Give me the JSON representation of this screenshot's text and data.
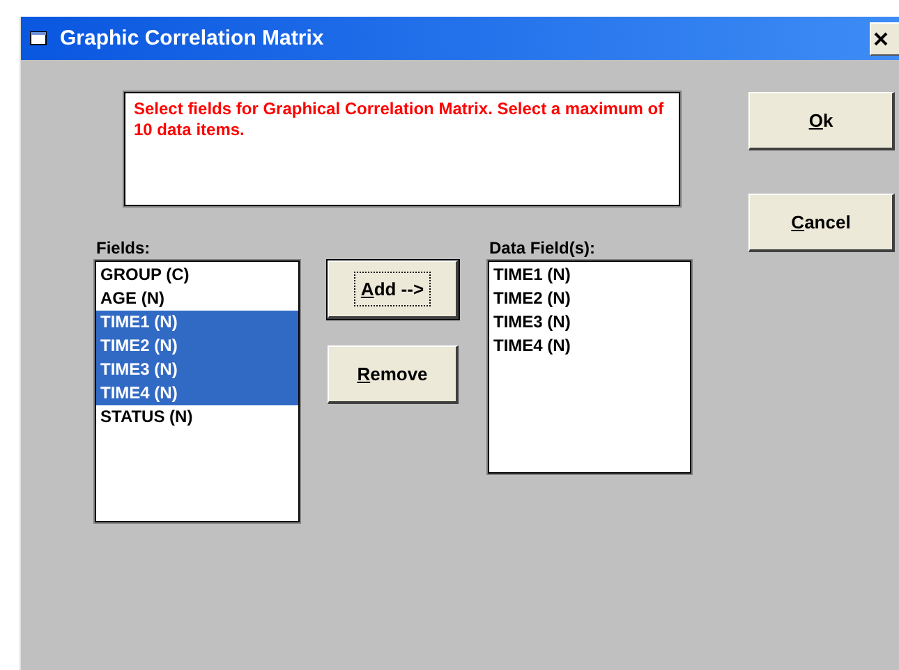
{
  "window": {
    "title": "Graphic Correlation Matrix"
  },
  "message": "Select fields for Graphical Correlation Matrix. Select a maximum of 10 data items.",
  "fields": {
    "label": "Fields:",
    "items": [
      {
        "text": "GROUP (C)",
        "selected": false
      },
      {
        "text": "AGE (N)",
        "selected": false
      },
      {
        "text": "TIME1 (N)",
        "selected": true
      },
      {
        "text": "TIME2 (N)",
        "selected": true
      },
      {
        "text": "TIME3 (N)",
        "selected": true
      },
      {
        "text": "TIME4 (N)",
        "selected": true
      },
      {
        "text": "STATUS (N)",
        "selected": false
      }
    ]
  },
  "move_buttons": [
    {
      "label": "Add -->",
      "focused": true
    },
    {
      "label": "Remove",
      "focused": false
    }
  ],
  "data_fields": {
    "label": "Data Field(s):",
    "items": [
      {
        "text": "TIME1 (N)",
        "selected": false
      },
      {
        "text": "TIME2 (N)",
        "selected": false
      },
      {
        "text": "TIME3 (N)",
        "selected": false
      },
      {
        "text": "TIME4 (N)",
        "selected": false
      }
    ]
  },
  "dialog_buttons": [
    {
      "label": "Ok",
      "focused": false
    },
    {
      "label": "Cancel",
      "focused": false
    }
  ]
}
